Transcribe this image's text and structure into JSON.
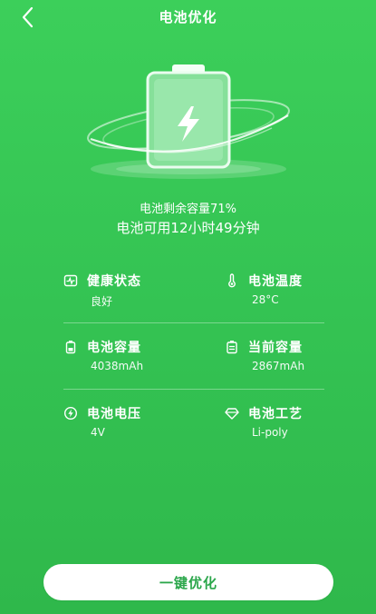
{
  "header": {
    "title": "电池优化",
    "back_icon": "chevron-left-icon"
  },
  "hero": {
    "icon": "battery-charging-icon",
    "colors": {
      "ring": "#d7f7df",
      "battery_fill": "#8fe3a1",
      "battery_outline": "#e9fbee",
      "bolt": "#ffffff"
    }
  },
  "summary": {
    "remaining_capacity_text": "电池剩余容量71%",
    "available_time_text": "电池可用12小时49分钟",
    "remaining_percent": 71
  },
  "stats": [
    {
      "label": "健康状态",
      "value": "良好",
      "icon": "health-monitor-icon"
    },
    {
      "label": "电池温度",
      "value": "28°C",
      "icon": "thermometer-icon"
    },
    {
      "label": "电池容量",
      "value": "4038mAh",
      "icon": "battery-capacity-icon"
    },
    {
      "label": "当前容量",
      "value": "2867mAh",
      "icon": "battery-current-icon"
    },
    {
      "label": "电池电压",
      "value": "4V",
      "icon": "voltage-icon"
    },
    {
      "label": "电池工艺",
      "value": "Li-poly",
      "icon": "diamond-icon"
    }
  ],
  "action": {
    "label": "一键优化"
  },
  "theme": {
    "background": "#34c353",
    "button_text": "#2aa64a",
    "button_bg": "#ffffff"
  }
}
